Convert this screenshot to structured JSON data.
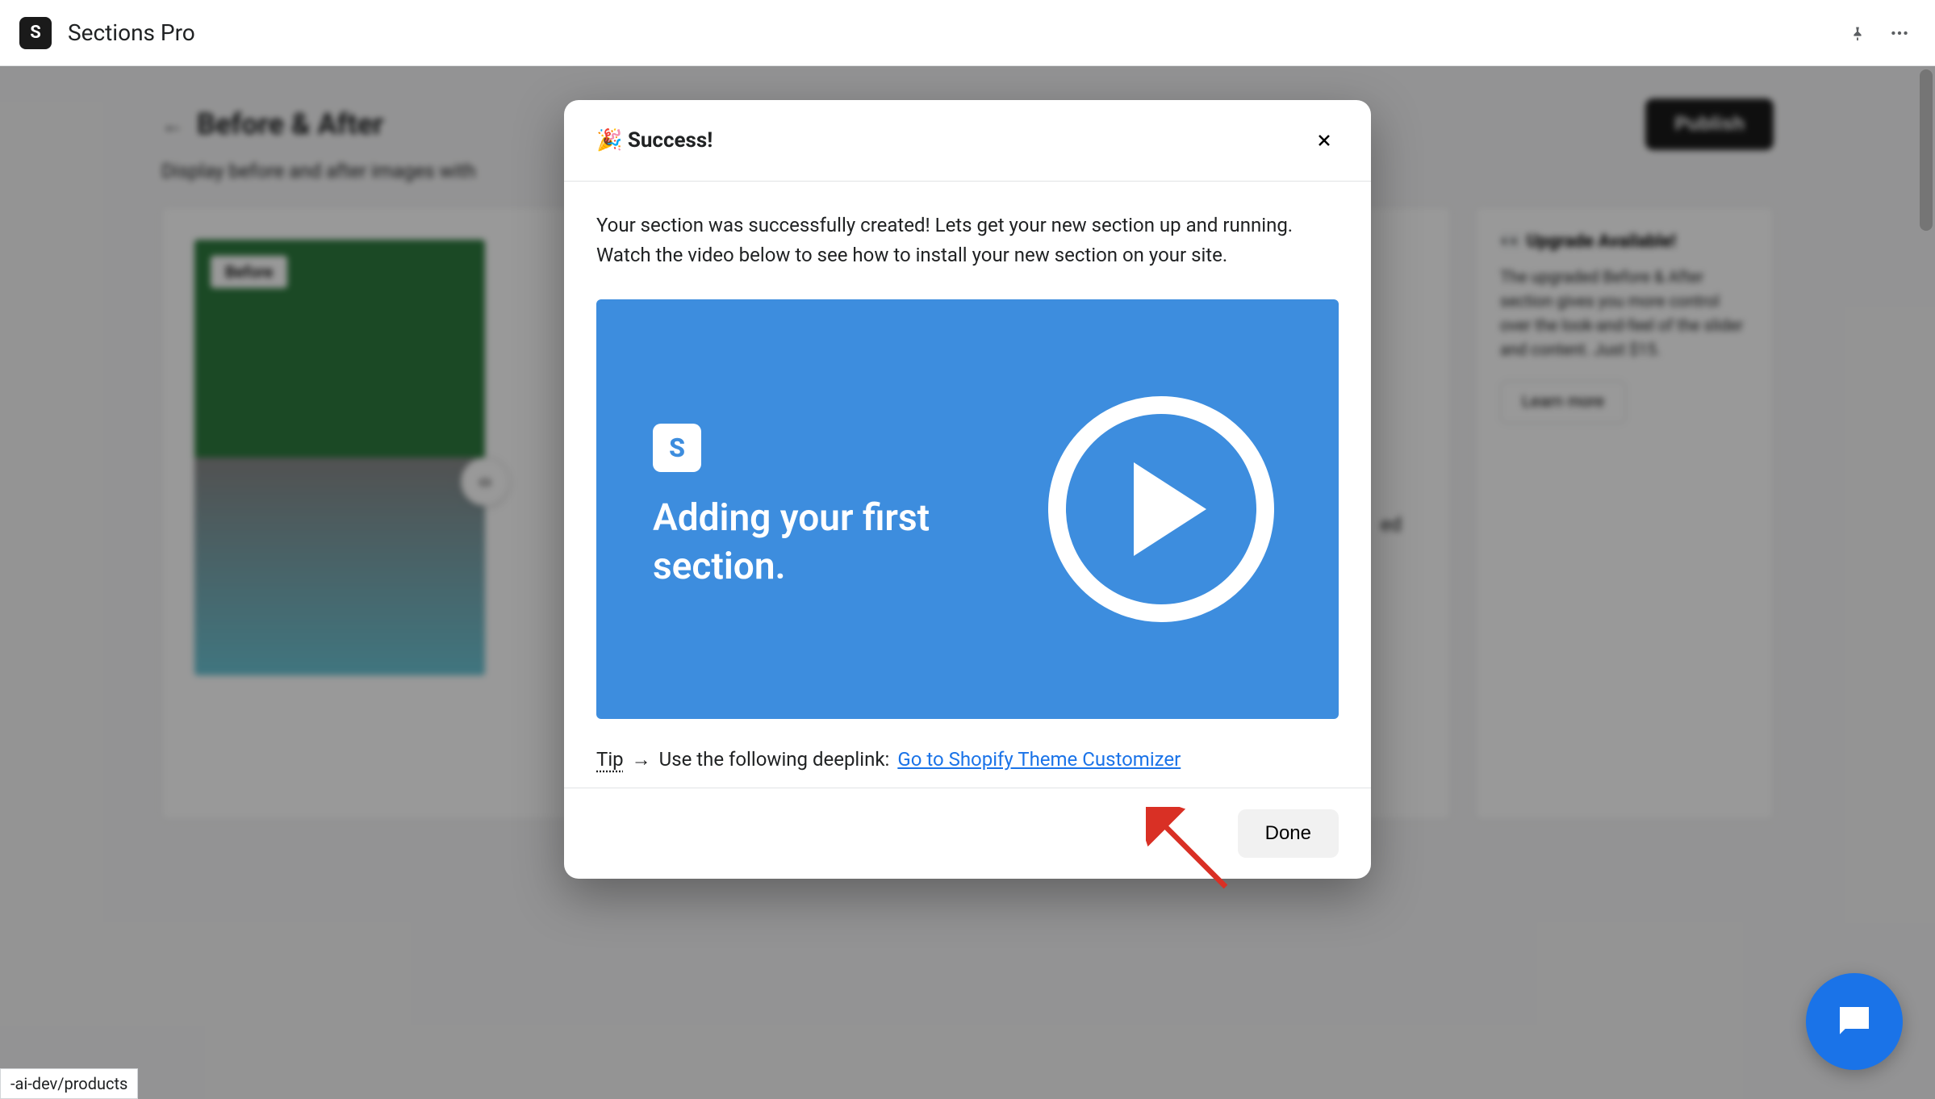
{
  "header": {
    "app_name": "Sections Pro",
    "logo_letter": "S"
  },
  "page": {
    "title": "Before & After",
    "subtitle": "Display before and after images with",
    "publish_label": "Publish",
    "before_badge": "Before",
    "description_fragment": "ed"
  },
  "upgrade": {
    "title": "👀 Upgrade Available!",
    "body": "The upgraded Before & After section gives you more control over the look-and-feel of the slider and content. Just $15.",
    "button": "Learn more"
  },
  "modal": {
    "title": "🎉 Success!",
    "message": "Your section was successfully created! Lets get your new section up and running. Watch the video below to see how to install your new section on your site.",
    "video_caption": "Adding your first section.",
    "tip_label": "Tip",
    "tip_arrow": "→",
    "tip_text": "Use the following deeplink:",
    "deeplink_label": "Go to Shopify Theme Customizer",
    "done_label": "Done"
  },
  "status_bar": "-ai-dev/products"
}
